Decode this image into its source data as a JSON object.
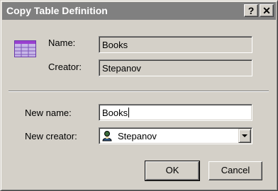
{
  "window": {
    "title": "Copy Table Definition",
    "help_label": "?",
    "close_label": "✕"
  },
  "source": {
    "name_label": "Name:",
    "name_value": "Books",
    "creator_label": "Creator:",
    "creator_value": "Stepanov",
    "icon": "table-icon"
  },
  "target": {
    "new_name_label": "New name:",
    "new_name_value": "Books",
    "new_creator_label": "New creator:",
    "new_creator_value": "Stepanov",
    "creator_icon": "user-icon"
  },
  "buttons": {
    "ok": "OK",
    "cancel": "Cancel"
  }
}
